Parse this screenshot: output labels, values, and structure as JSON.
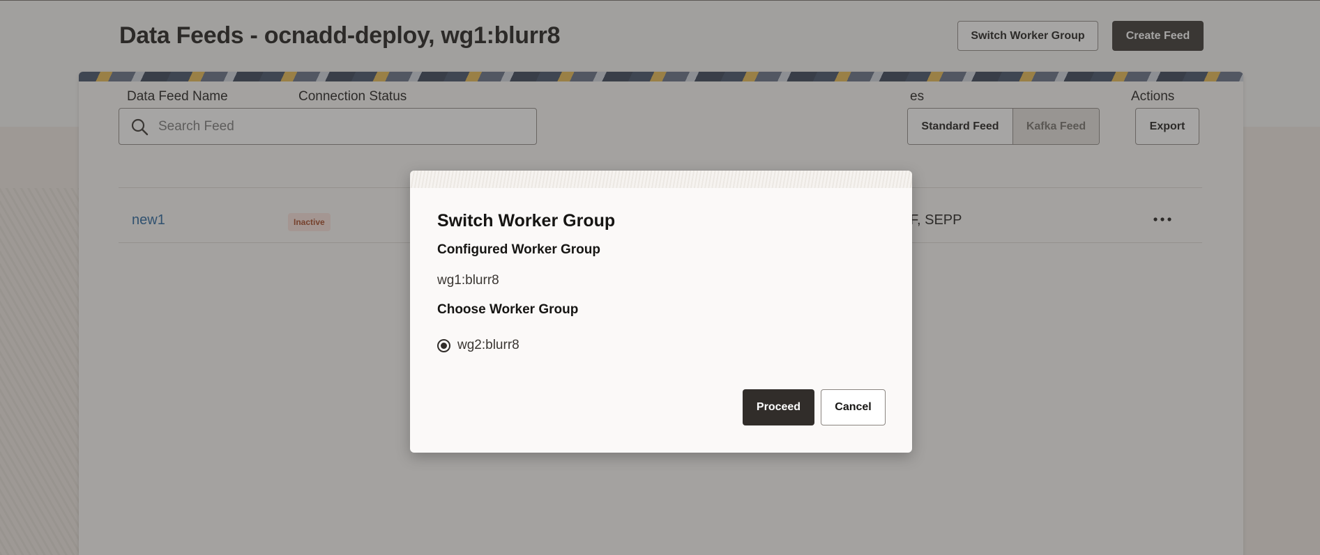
{
  "header": {
    "title": "Data Feeds - ocnadd-deploy, wg1:blurr8",
    "switch_worker_group_label": "Switch Worker Group",
    "create_feed_label": "Create Feed"
  },
  "toolbar": {
    "search_placeholder": "Search Feed",
    "feed_types": [
      "Standard Feed",
      "Kafka Feed"
    ],
    "selected_feed_type": "Standard Feed",
    "export_label": "Export"
  },
  "table": {
    "columns": {
      "name": "Data Feed Name",
      "status": "Connection Status",
      "types": "es",
      "actions": "Actions"
    },
    "rows": [
      {
        "name": "new1",
        "status": "Inactive",
        "types": "F, SEPP"
      }
    ]
  },
  "dialog": {
    "title": "Switch Worker Group",
    "configured_label": "Configured Worker Group",
    "configured_value": "wg1:blurr8",
    "choose_label": "Choose Worker Group",
    "options": [
      "wg2:blurr8"
    ],
    "selected_option": "wg2:blurr8",
    "proceed_label": "Proceed",
    "cancel_label": "Cancel"
  },
  "colors": {
    "primary_button": "#312d2a",
    "link": "#1e5f9a",
    "badge_bg": "#fbe3dc",
    "badge_text": "#a3401c"
  },
  "icons": {
    "search": "search-icon",
    "row_menu": "more-horizontal-icon",
    "radio": "radio-selected-icon"
  }
}
